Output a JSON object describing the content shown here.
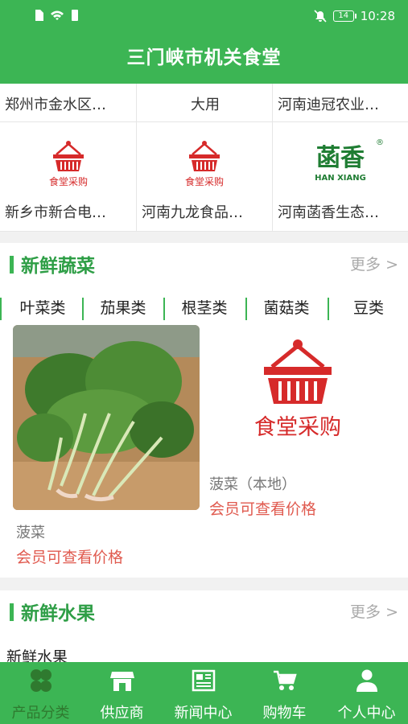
{
  "status_bar": {
    "battery": "14",
    "time": "10:28"
  },
  "header": {
    "title": "三门峡市机关食堂"
  },
  "suppliers": [
    {
      "name": "郑州市金水区…"
    },
    {
      "name": "大用"
    },
    {
      "name": "河南迪冠农业…"
    },
    {
      "name": "新乡市新合电…"
    },
    {
      "name": "河南九龙食品…"
    },
    {
      "name": "河南菡香生态…"
    }
  ],
  "logo_text": {
    "canteen": "食堂采购",
    "hanxiang_cn": "菡香",
    "hanxiang_en": "HAN XIANG",
    "registered": "®"
  },
  "vegetables": {
    "title": "新鲜蔬菜",
    "more": "更多 >",
    "tabs": [
      "叶菜类",
      "茄果类",
      "根茎类",
      "菌菇类",
      "豆类"
    ],
    "products": [
      {
        "name": "菠菜",
        "price": "会员可查看价格"
      },
      {
        "name": "菠菜（本地）",
        "price": "会员可查看价格"
      }
    ]
  },
  "fruits": {
    "title": "新鲜水果",
    "more": "更多 >",
    "subtitle": "新鲜水果"
  },
  "bottom_nav": [
    {
      "label": "产品分类",
      "icon": "category-icon",
      "active": true
    },
    {
      "label": "供应商",
      "icon": "store-icon",
      "active": false
    },
    {
      "label": "新闻中心",
      "icon": "news-icon",
      "active": false
    },
    {
      "label": "购物车",
      "icon": "cart-icon",
      "active": false
    },
    {
      "label": "个人中心",
      "icon": "user-icon",
      "active": false
    }
  ],
  "colors": {
    "primary": "#3cb554",
    "accent_text": "#2e9e46",
    "price": "#e05a4f",
    "logo_red": "#d62a2a"
  }
}
